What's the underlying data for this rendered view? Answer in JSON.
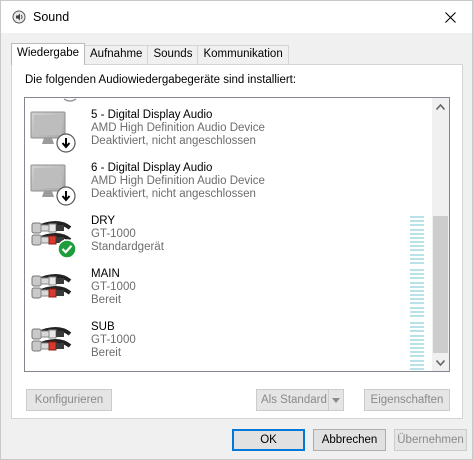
{
  "window": {
    "title": "Sound",
    "close_glyph": "✕"
  },
  "tabs": [
    {
      "label": "Wiedergabe",
      "active": true
    },
    {
      "label": "Aufnahme",
      "active": false
    },
    {
      "label": "Sounds",
      "active": false
    },
    {
      "label": "Kommunikation",
      "active": false
    }
  ],
  "panel": {
    "label": "Die folgenden Audiowiedergabegeräte sind installiert:"
  },
  "devices": [
    {
      "name": "5 - Digital Display Audio",
      "description": "AMD High Definition Audio Device",
      "status": "Deaktiviert, nicht angeschlossen",
      "icon": "monitor-icon"
    },
    {
      "name": "6 - Digital Display Audio",
      "description": "AMD High Definition Audio Device",
      "status": "Deaktiviert, nicht angeschlossen",
      "icon": "monitor-icon"
    },
    {
      "name": "DRY",
      "description": "GT-1000",
      "status": "Standardgerät",
      "icon": "rca-cable-icon",
      "default": true
    },
    {
      "name": "MAIN",
      "description": "GT-1000",
      "status": "Bereit",
      "icon": "rca-cable-icon"
    },
    {
      "name": "SUB",
      "description": "GT-1000",
      "status": "Bereit",
      "icon": "rca-cable-icon"
    }
  ],
  "panel_buttons": {
    "configure": "Konfigurieren",
    "set_default": "Als Standard",
    "properties": "Eigenschaften"
  },
  "dialog_buttons": {
    "ok": "OK",
    "cancel": "Abbrechen",
    "apply": "Übernehmen"
  },
  "colors": {
    "accent": "#0078d7",
    "meter": "#b9e1e8",
    "default_check": "#1e9e3a"
  }
}
